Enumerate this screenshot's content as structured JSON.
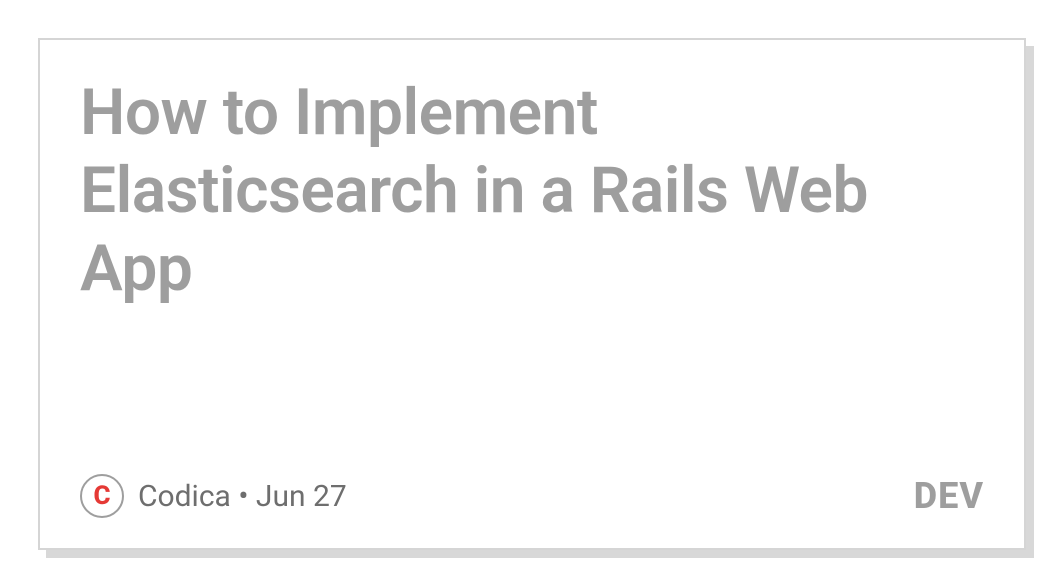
{
  "card": {
    "title": "How to Implement Elasticsearch in a Rails Web App",
    "author": {
      "avatar_letter": "C",
      "name": "Codica",
      "separator": " • ",
      "date": "Jun 27"
    },
    "brand": "DEV"
  }
}
